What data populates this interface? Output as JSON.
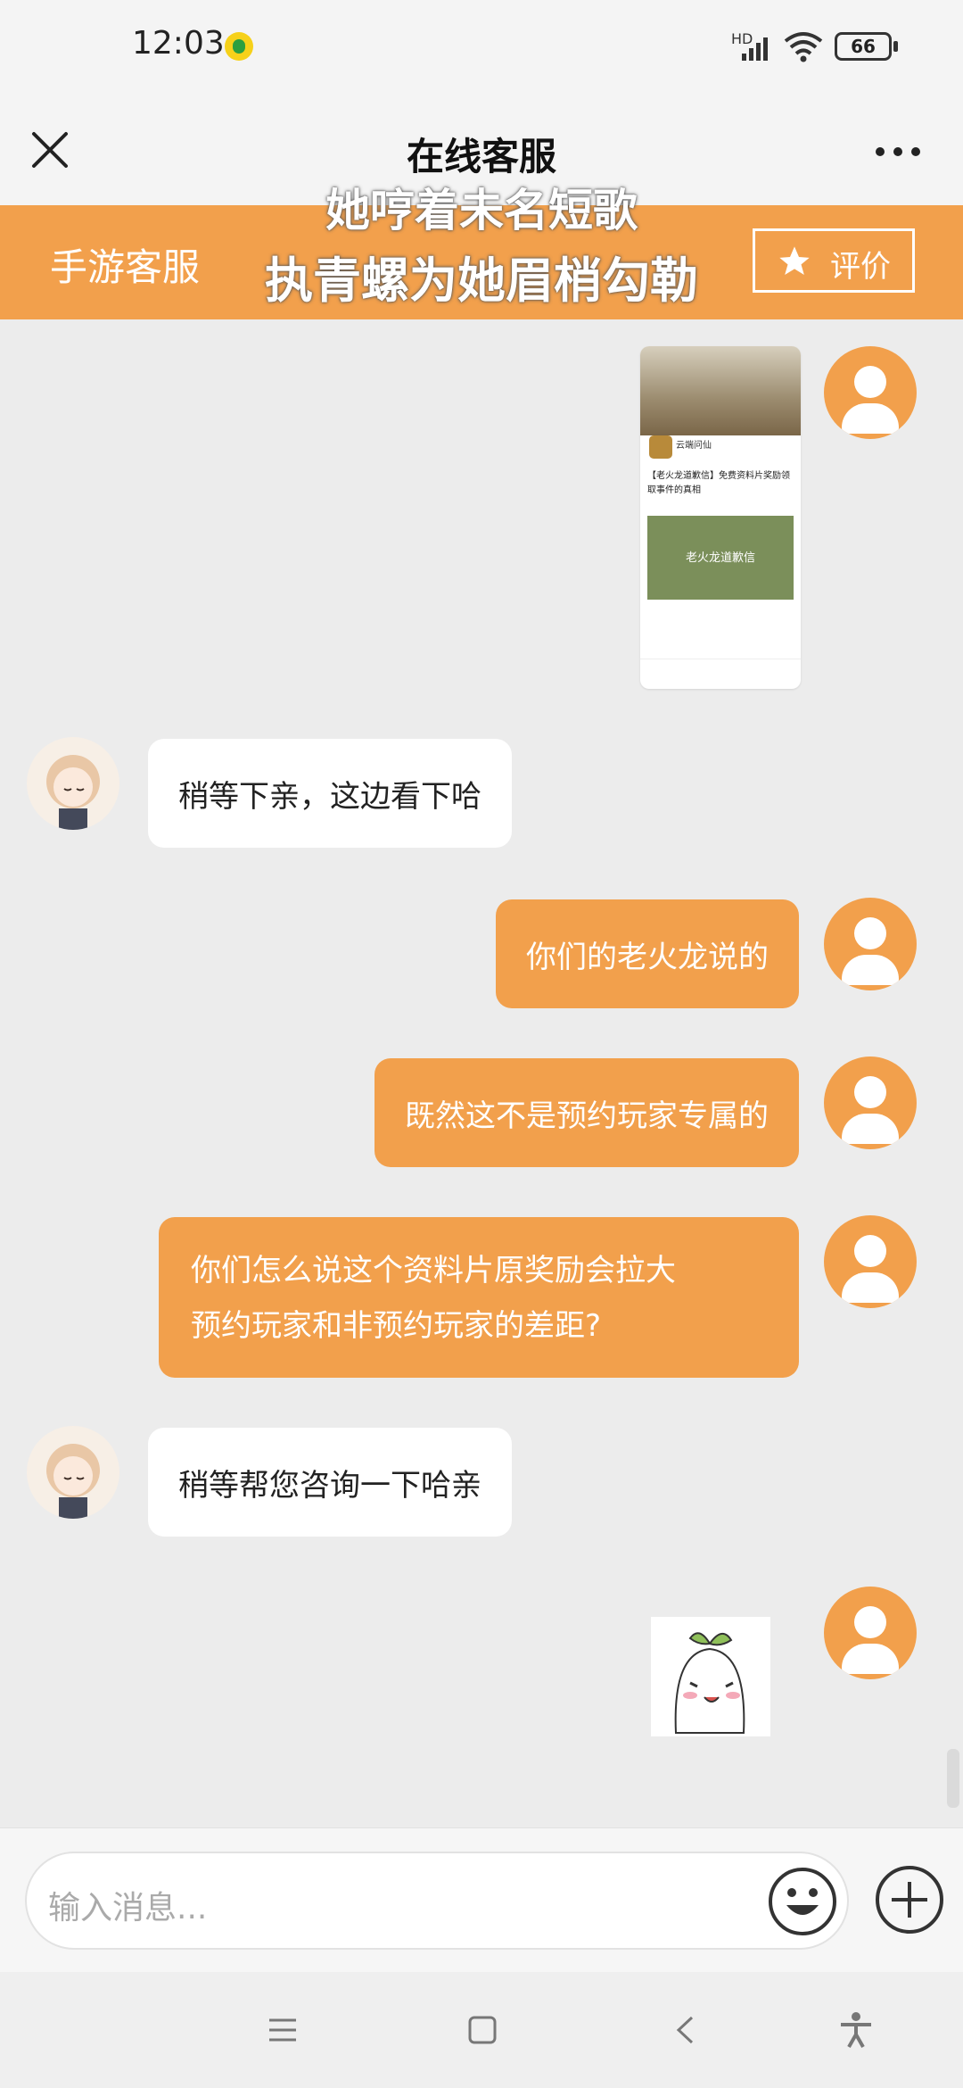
{
  "status": {
    "time": "12:03",
    "battery": "66",
    "network": "HD"
  },
  "header": {
    "title": "在线客服"
  },
  "banner": {
    "left_label": "手游客服",
    "rating_label": "评价"
  },
  "overlay_lyrics": {
    "line1": "她哼着未名短歌",
    "line2": "执青螺为她眉梢勾勒"
  },
  "shared_card": {
    "title": "云端问仙",
    "headline": "【老火龙道歉信】免费资料片奖励领取事件的真相",
    "image_text": "老火龙道歉信"
  },
  "messages": [
    {
      "from": "agent",
      "text": "稍等下亲，这边看下哈"
    },
    {
      "from": "user",
      "text": "你们的老火龙说的"
    },
    {
      "from": "user",
      "text": "既然这不是预约玩家专属的"
    },
    {
      "from": "user",
      "line1": "你们怎么说这个资料片原奖励会拉大",
      "line2": "预约玩家和非预约玩家的差距?"
    },
    {
      "from": "agent",
      "text": "稍等帮您咨询一下哈亲"
    }
  ],
  "composer": {
    "placeholder": "输入消息..."
  },
  "colors": {
    "accent": "#f2a04c",
    "background": "#ececec",
    "bubble_in": "#ffffff"
  }
}
